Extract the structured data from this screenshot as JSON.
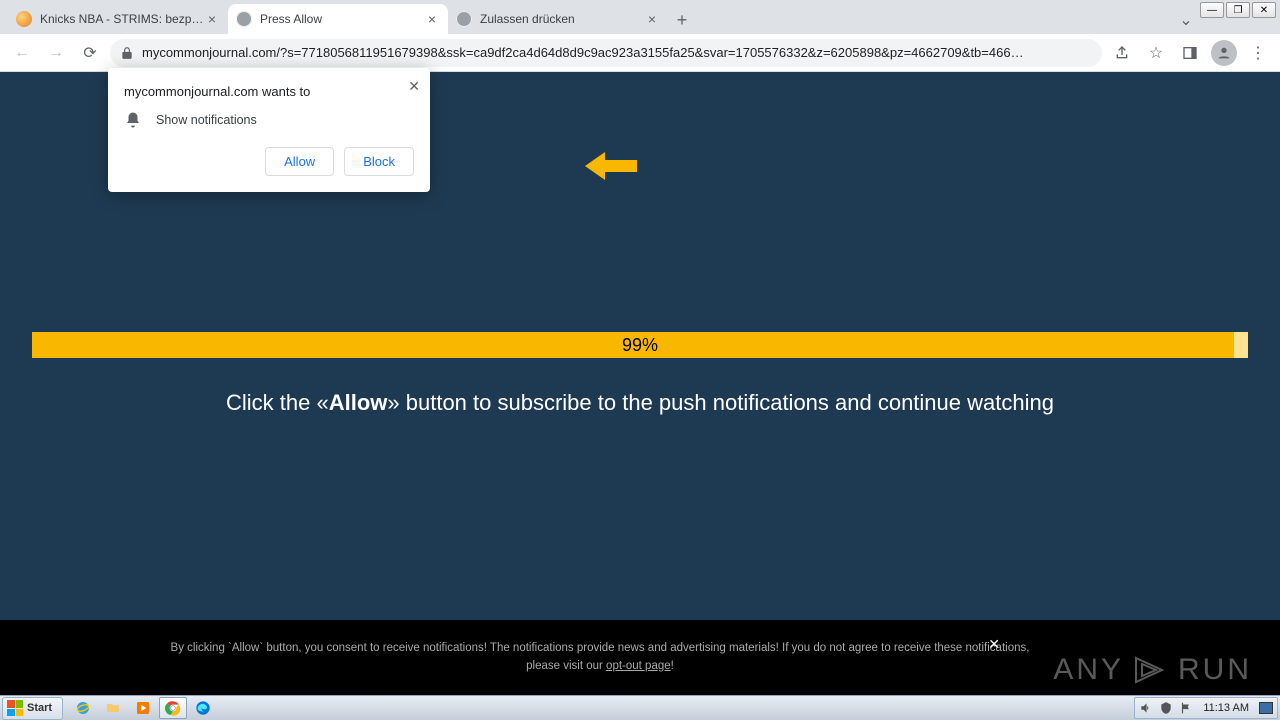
{
  "window": {
    "tabs": [
      {
        "title": "Knicks NBA - STRIMS: bezpłatna tran"
      },
      {
        "title": "Press Allow"
      },
      {
        "title": "Zulassen drücken"
      }
    ]
  },
  "toolbar": {
    "url": "mycommonjournal.com/?s=7718056811951679398&ssk=ca9df2ca4d64d8d9c9ac923a3155fa25&svar=1705576332&z=6205898&pz=4662709&tb=466…"
  },
  "permission": {
    "origin_line": "mycommonjournal.com wants to",
    "capability": "Show notifications",
    "allow": "Allow",
    "block": "Block"
  },
  "page": {
    "progress_pct": "99%",
    "instruction_pre": "Click the «",
    "instruction_strong": "Allow",
    "instruction_post": "» button to subscribe to the push notifications and continue watching"
  },
  "footer": {
    "line1": "By clicking `Allow` button, you consent to receive notifications! The notifications provide news and advertising materials! If you do not agree to receive these notifications,",
    "line2_pre": "please visit our ",
    "optout": "opt-out page",
    "line2_post": "!"
  },
  "watermark": {
    "brand_a": "ANY",
    "brand_b": "RUN"
  },
  "taskbar": {
    "start": "Start",
    "clock": "11:13 AM"
  }
}
